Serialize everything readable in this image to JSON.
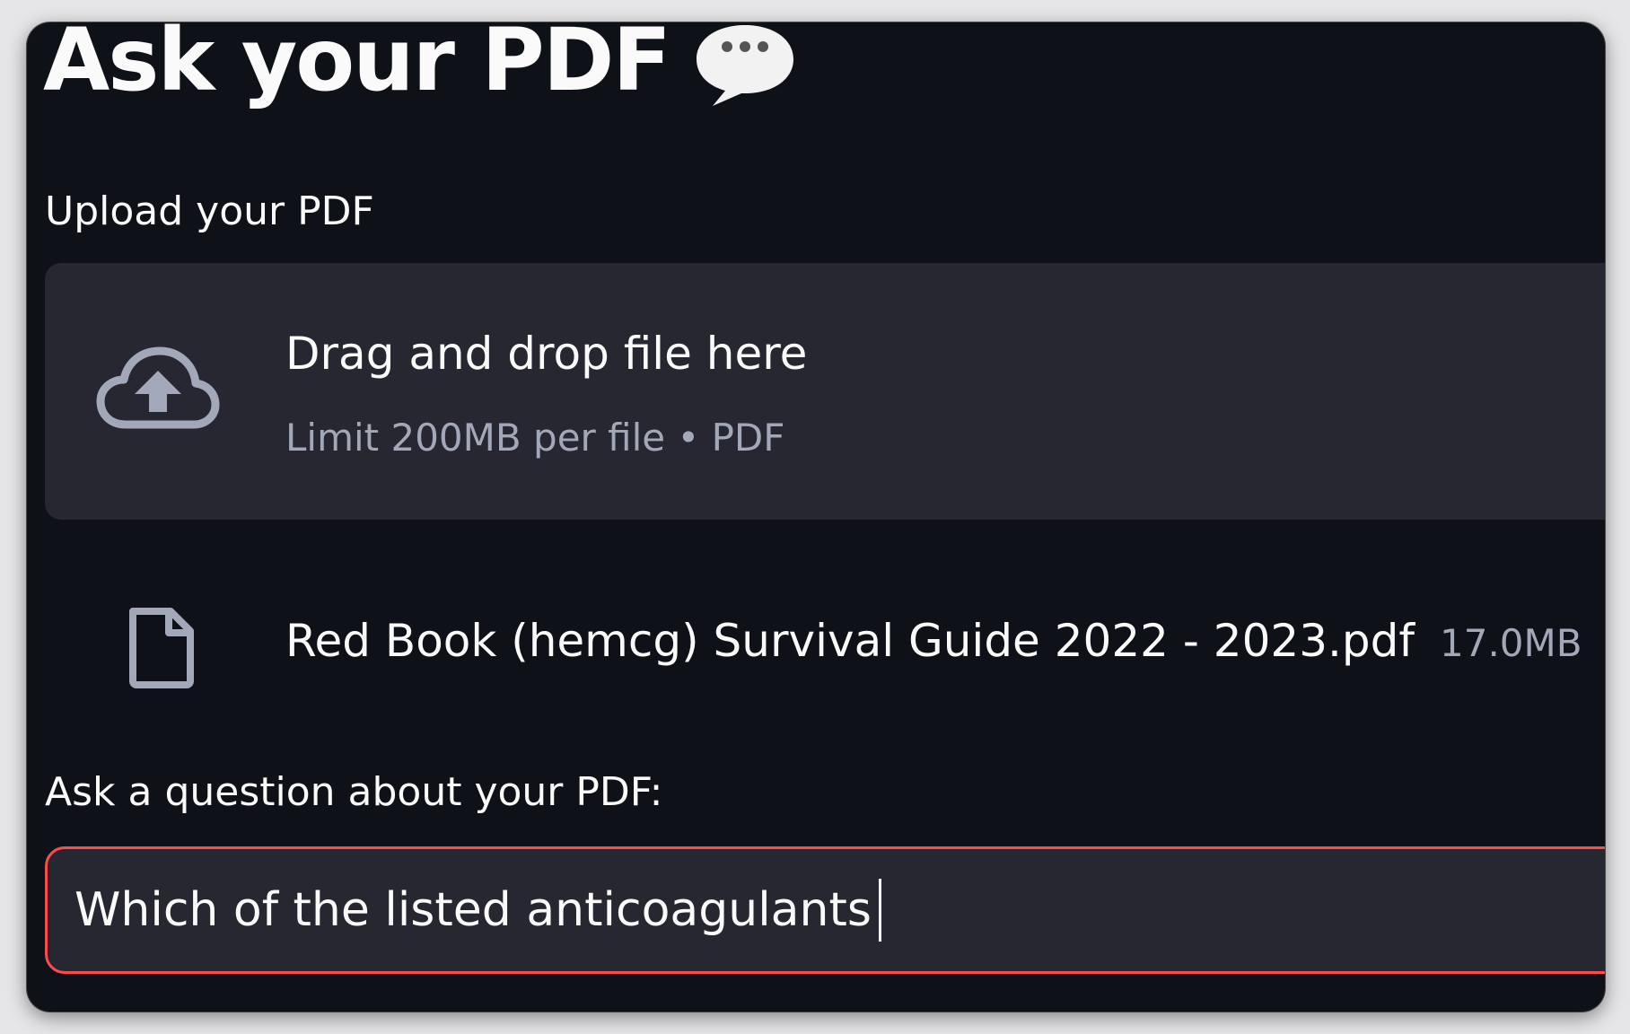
{
  "header": {
    "title": "Ask your PDF",
    "title_icon": "speech-bubble-icon"
  },
  "uploader": {
    "label": "Upload your PDF",
    "dropzone_title": "Drag and drop file here",
    "dropzone_subtitle": "Limit 200MB per file • PDF",
    "icon": "cloud-upload-icon"
  },
  "uploaded_file": {
    "icon": "file-icon",
    "name": "Red Book (hemcg) Survival Guide 2022 - 2023.pdf",
    "size": "17.0MB"
  },
  "question": {
    "label": "Ask a question about your PDF:",
    "value": "Which of the listed anticoagulants"
  },
  "colors": {
    "background": "#0e1117",
    "panel": "#262730",
    "focus_border": "#ff4b4b",
    "text": "#fafafa",
    "muted_text": "#a3a8b8"
  }
}
